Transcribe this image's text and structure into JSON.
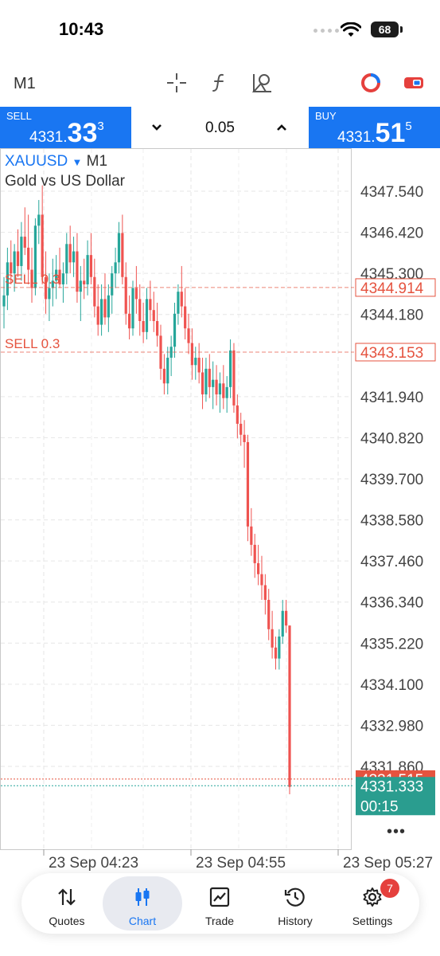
{
  "status_bar": {
    "time": "10:43",
    "battery": "68"
  },
  "toolbar": {
    "timeframe": "M1"
  },
  "trade": {
    "sell_label": "SELL",
    "sell_price": {
      "small": "4331.",
      "big": "33",
      "sup": "3"
    },
    "buy_label": "BUY",
    "buy_price": {
      "small": "4331.",
      "big": "51",
      "sup": "5"
    },
    "volume": "0.05"
  },
  "chart": {
    "symbol": "XAUUSD",
    "timeframe": "M1",
    "description": "Gold vs US Dollar",
    "more": "•••"
  },
  "chart_data": {
    "type": "candlestick",
    "symbol": "XAUUSD",
    "price_ticks": [
      "4347.540",
      "4346.420",
      "4345.300",
      "4344.180",
      "4341.940",
      "4340.820",
      "4339.700",
      "4338.580",
      "4337.460",
      "4336.340",
      "4335.220",
      "4334.100",
      "4332.980",
      "4331.860"
    ],
    "time_ticks": [
      "23 Sep 04:23",
      "23 Sep 04:55",
      "23 Sep 05:27"
    ],
    "y_range": [
      4330.0,
      4348.5
    ],
    "orders": [
      {
        "label": "SELL 0.3",
        "price": "4344.914"
      },
      {
        "label": "SELL 0.3",
        "price": "4343.153"
      }
    ],
    "ask_price": "4331.515",
    "bid_price": "4331.333",
    "bar_timer": "00:15",
    "colors": {
      "bull": "#26a69a",
      "bear": "#ef5350",
      "order": "#e5533f",
      "ask": "#e5533f",
      "bid": "#26a69a"
    },
    "candles": [
      [
        4344.4,
        4345.2,
        4343.8,
        4344.7
      ],
      [
        4344.7,
        4346.0,
        4344.3,
        4345.6
      ],
      [
        4345.6,
        4346.2,
        4345.0,
        4345.3
      ],
      [
        4345.3,
        4346.1,
        4344.8,
        4345.9
      ],
      [
        4345.9,
        4346.5,
        4345.2,
        4345.5
      ],
      [
        4345.5,
        4346.7,
        4345.1,
        4346.3
      ],
      [
        4346.3,
        4347.1,
        4345.8,
        4346.0
      ],
      [
        4346.0,
        4346.9,
        4345.0,
        4345.4
      ],
      [
        4345.4,
        4346.0,
        4344.5,
        4344.9
      ],
      [
        4344.9,
        4346.8,
        4344.7,
        4346.6
      ],
      [
        4346.6,
        4347.3,
        4346.1,
        4346.9
      ],
      [
        4346.9,
        4347.7,
        4345.0,
        4345.2
      ],
      [
        4345.2,
        4345.9,
        4344.2,
        4344.6
      ],
      [
        4344.6,
        4345.3,
        4344.0,
        4344.9
      ],
      [
        4344.9,
        4345.7,
        4344.4,
        4345.1
      ],
      [
        4345.1,
        4345.8,
        4344.6,
        4345.4
      ],
      [
        4345.4,
        4346.0,
        4344.9,
        4345.0
      ],
      [
        4345.0,
        4345.6,
        4344.5,
        4345.3
      ],
      [
        4345.3,
        4346.4,
        4345.0,
        4346.1
      ],
      [
        4346.1,
        4346.6,
        4345.3,
        4345.6
      ],
      [
        4345.6,
        4346.3,
        4345.2,
        4345.9
      ],
      [
        4345.9,
        4346.4,
        4344.5,
        4344.8
      ],
      [
        4344.8,
        4345.5,
        4344.0,
        4345.1
      ],
      [
        4345.1,
        4345.7,
        4344.6,
        4345.0
      ],
      [
        4345.0,
        4346.2,
        4344.7,
        4345.8
      ],
      [
        4345.8,
        4346.4,
        4345.0,
        4345.2
      ],
      [
        4345.2,
        4345.7,
        4344.1,
        4344.4
      ],
      [
        4344.4,
        4345.0,
        4343.6,
        4343.9
      ],
      [
        4343.9,
        4345.0,
        4343.6,
        4344.6
      ],
      [
        4344.6,
        4345.3,
        4343.9,
        4344.1
      ],
      [
        4344.1,
        4345.0,
        4343.7,
        4344.7
      ],
      [
        4344.7,
        4345.5,
        4344.2,
        4345.3
      ],
      [
        4345.3,
        4346.0,
        4344.9,
        4345.6
      ],
      [
        4345.6,
        4346.7,
        4345.3,
        4346.4
      ],
      [
        4346.4,
        4346.9,
        4345.0,
        4345.2
      ],
      [
        4345.2,
        4345.6,
        4343.9,
        4344.2
      ],
      [
        4344.2,
        4344.7,
        4343.5,
        4343.8
      ],
      [
        4343.8,
        4345.1,
        4343.6,
        4344.9
      ],
      [
        4344.9,
        4345.5,
        4344.2,
        4344.6
      ],
      [
        4344.6,
        4345.0,
        4343.6,
        4344.0
      ],
      [
        4344.0,
        4344.5,
        4343.4,
        4343.7
      ],
      [
        4343.7,
        4344.9,
        4343.5,
        4344.6
      ],
      [
        4344.6,
        4345.1,
        4344.0,
        4344.3
      ],
      [
        4344.3,
        4344.8,
        4343.7,
        4344.0
      ],
      [
        4344.0,
        4344.5,
        4343.3,
        4343.6
      ],
      [
        4343.6,
        4343.9,
        4342.4,
        4342.7
      ],
      [
        4342.7,
        4343.1,
        4342.0,
        4342.3
      ],
      [
        4342.3,
        4343.3,
        4342.0,
        4343.0
      ],
      [
        4343.0,
        4343.6,
        4342.5,
        4343.3
      ],
      [
        4343.3,
        4344.5,
        4343.0,
        4344.2
      ],
      [
        4344.2,
        4345.0,
        4343.9,
        4344.8
      ],
      [
        4344.8,
        4345.5,
        4344.1,
        4344.4
      ],
      [
        4344.4,
        4344.9,
        4343.5,
        4343.8
      ],
      [
        4343.8,
        4344.2,
        4343.1,
        4343.4
      ],
      [
        4343.4,
        4343.8,
        4342.4,
        4342.8
      ],
      [
        4342.8,
        4343.3,
        4342.4,
        4343.0
      ],
      [
        4343.0,
        4343.4,
        4342.3,
        4342.6
      ],
      [
        4342.6,
        4343.0,
        4341.6,
        4342.0
      ],
      [
        4342.0,
        4343.0,
        4341.8,
        4342.7
      ],
      [
        4342.7,
        4343.1,
        4341.9,
        4342.2
      ],
      [
        4342.2,
        4342.9,
        4341.6,
        4342.4
      ],
      [
        4342.4,
        4342.8,
        4341.7,
        4342.0
      ],
      [
        4342.0,
        4342.6,
        4341.5,
        4342.3
      ],
      [
        4342.3,
        4342.8,
        4341.6,
        4341.9
      ],
      [
        4341.9,
        4342.5,
        4341.5,
        4342.2
      ],
      [
        4342.2,
        4343.5,
        4341.9,
        4343.2
      ],
      [
        4343.2,
        4343.4,
        4341.5,
        4341.7
      ],
      [
        4341.7,
        4342.0,
        4340.8,
        4341.2
      ],
      [
        4341.2,
        4341.5,
        4340.6,
        4340.9
      ],
      [
        4340.9,
        4341.3,
        4340.0,
        4340.7
      ],
      [
        4340.7,
        4340.9,
        4338.0,
        4338.4
      ],
      [
        4338.4,
        4338.9,
        4337.6,
        4337.9
      ],
      [
        4337.9,
        4338.2,
        4337.0,
        4337.4
      ],
      [
        4337.4,
        4337.9,
        4336.8,
        4337.1
      ],
      [
        4337.1,
        4337.6,
        4336.4,
        4336.8
      ],
      [
        4336.8,
        4337.1,
        4336.0,
        4336.4
      ],
      [
        4336.4,
        4336.7,
        4335.3,
        4335.6
      ],
      [
        4335.6,
        4336.1,
        4334.8,
        4335.1
      ],
      [
        4335.1,
        4335.4,
        4334.5,
        4334.8
      ],
      [
        4334.8,
        4335.6,
        4334.5,
        4335.4
      ],
      [
        4335.4,
        4336.4,
        4335.2,
        4336.1
      ],
      [
        4336.1,
        4336.4,
        4335.5,
        4335.7
      ],
      [
        4335.7,
        4335.7,
        4331.1,
        4331.3
      ]
    ]
  },
  "nav": {
    "items": [
      {
        "label": "Quotes",
        "icon": "arrows-updown-icon"
      },
      {
        "label": "Chart",
        "icon": "candlestick-icon"
      },
      {
        "label": "Trade",
        "icon": "trend-chart-icon"
      },
      {
        "label": "History",
        "icon": "clock-history-icon"
      },
      {
        "label": "Settings",
        "icon": "gear-icon"
      }
    ],
    "settings_badge": "7"
  }
}
